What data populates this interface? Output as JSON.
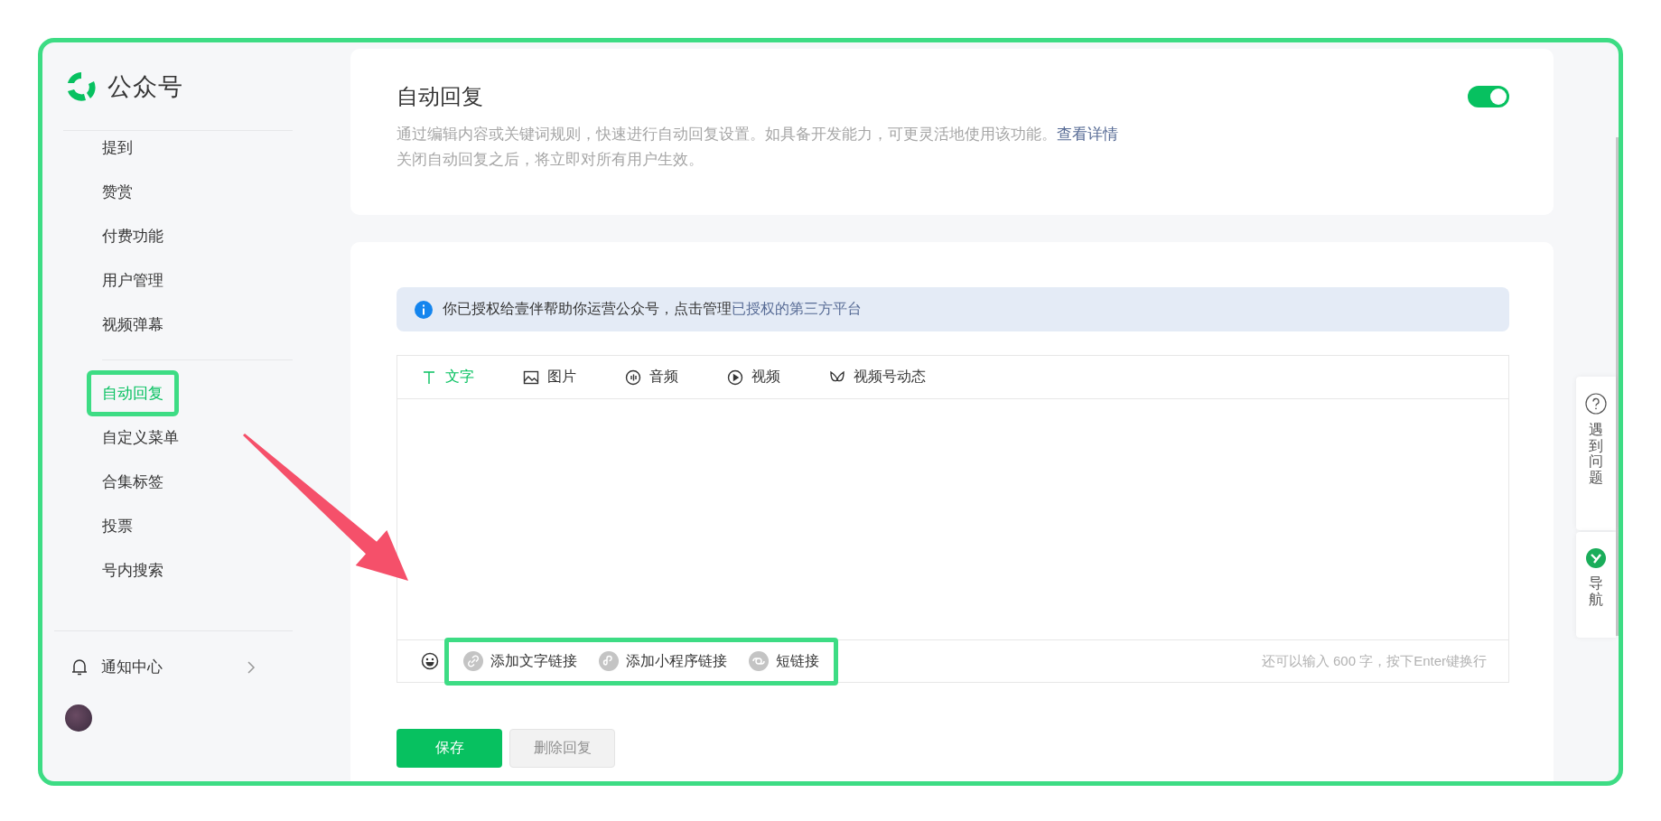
{
  "app": {
    "name": "公众号"
  },
  "sidebar": {
    "groups": [
      {
        "items": [
          {
            "label": "提到",
            "selected": false
          },
          {
            "label": "赞赏",
            "selected": false
          },
          {
            "label": "付费功能",
            "selected": false
          },
          {
            "label": "用户管理",
            "selected": false
          },
          {
            "label": "视频弹幕",
            "selected": false
          }
        ]
      },
      {
        "items": [
          {
            "label": "自动回复",
            "selected": true
          },
          {
            "label": "自定义菜单",
            "selected": false
          },
          {
            "label": "合集标签",
            "selected": false
          },
          {
            "label": "投票",
            "selected": false
          },
          {
            "label": "号内搜索",
            "selected": false
          }
        ]
      }
    ],
    "notifications": {
      "label": "通知中心"
    }
  },
  "settings_card": {
    "title": "自动回复",
    "enabled": true,
    "description": "通过编辑内容或关键词规则，快速进行自动回复设置。如具备开发能力，可更灵活地使用该功能。",
    "details_link": "查看详情",
    "note": "关闭自动回复之后，将立即对所有用户生效。"
  },
  "notice": {
    "text": "你已授权给壹伴帮助你运营公众号，点击管理",
    "link": "已授权的第三方平台"
  },
  "editor": {
    "tabs": [
      {
        "kind": "text",
        "label": "文字",
        "selected": true
      },
      {
        "kind": "image",
        "label": "图片",
        "selected": false
      },
      {
        "kind": "audio",
        "label": "音频",
        "selected": false
      },
      {
        "kind": "video",
        "label": "视频",
        "selected": false
      },
      {
        "kind": "channels",
        "label": "视频号动态",
        "selected": false
      }
    ],
    "link_buttons": [
      {
        "kind": "text_link",
        "label": "添加文字链接"
      },
      {
        "kind": "miniprogram",
        "label": "添加小程序链接"
      },
      {
        "kind": "short_link",
        "label": "短链接"
      }
    ],
    "hint": "还可以输入 600 字，按下Enter键换行"
  },
  "buttons": [
    {
      "kind": "primary",
      "label": "保存",
      "disabled": false
    },
    {
      "kind": "secondary",
      "label": "删除回复",
      "disabled": true
    }
  ],
  "help_panel": [
    {
      "kind": "help",
      "label": "遇到问题"
    },
    {
      "kind": "nav",
      "label": "导航"
    }
  ]
}
